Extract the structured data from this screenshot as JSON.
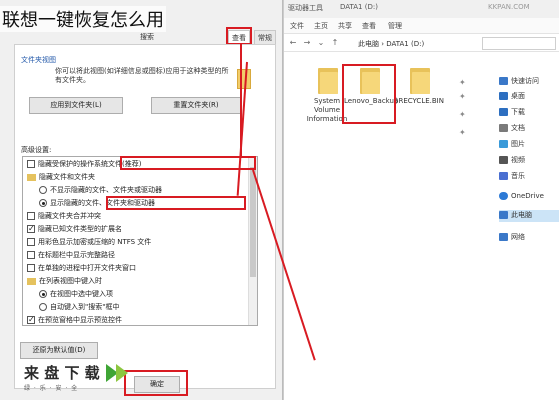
{
  "caption": "联想一键恢复怎么用",
  "explorer": {
    "tabs": [
      "文件",
      "主页",
      "共享",
      "查看",
      "驱动器工具",
      "管理",
      "DATA1 (D:)",
      "KKPAN.COM"
    ],
    "path": "此电脑 › DATA1 (D:)",
    "files": [
      {
        "name": "$RECYCLE.BIN"
      },
      {
        "name": "Lenovo_Backup"
      },
      {
        "name": "System Volume Information"
      }
    ],
    "nav": [
      {
        "label": "快速访问",
        "color": "#3a78c8"
      },
      {
        "label": "桌面",
        "color": "#2d6fc0"
      },
      {
        "label": "下载",
        "color": "#2d6fc0"
      },
      {
        "label": "文档",
        "color": "#7a7a7a"
      },
      {
        "label": "图片",
        "color": "#3a9ad9"
      },
      {
        "label": "视频",
        "color": "#555"
      },
      {
        "label": "音乐",
        "color": "#4a6fd1"
      },
      {
        "label": "OneDrive",
        "color": "#2d7ad6"
      },
      {
        "label": "此电脑",
        "color": "#3a78c8"
      },
      {
        "label": "网络",
        "color": "#3a78c8"
      }
    ]
  },
  "dialog": {
    "tabs": [
      "查看",
      "常规"
    ],
    "subtab": "搜索",
    "folder_views": {
      "title": "文件夹视图",
      "text": "你可以将此视图(如详细信息或图标)应用于这种类型的所有文件夹。",
      "apply_button": "应用到文件夹(L)",
      "reset_button": "重置文件夹(R)"
    },
    "advanced": {
      "title": "高级设置:",
      "items": [
        {
          "kind": "checkbox",
          "checked": false,
          "label": "隐藏受保护的操作系统文件(推荐)",
          "indent": 0
        },
        {
          "kind": "folder",
          "label": "隐藏文件和文件夹",
          "indent": 0
        },
        {
          "kind": "radio",
          "checked": false,
          "label": "不显示隐藏的文件、文件夹或驱动器",
          "indent": 1
        },
        {
          "kind": "radio",
          "checked": true,
          "label": "显示隐藏的文件、文件夹和驱动器",
          "indent": 1
        },
        {
          "kind": "checkbox",
          "checked": false,
          "label": "隐藏文件夹合并冲突",
          "indent": 0
        },
        {
          "kind": "checkbox",
          "checked": true,
          "label": "隐藏已知文件类型的扩展名",
          "indent": 0
        },
        {
          "kind": "checkbox",
          "checked": false,
          "label": "用彩色显示加密或压缩的 NTFS 文件",
          "indent": 0
        },
        {
          "kind": "checkbox",
          "checked": false,
          "label": "在标题栏中显示完整路径",
          "indent": 0
        },
        {
          "kind": "checkbox",
          "checked": false,
          "label": "在单独的进程中打开文件夹窗口",
          "indent": 0
        },
        {
          "kind": "folder",
          "label": "在列表视图中键入时",
          "indent": 0
        },
        {
          "kind": "radio",
          "checked": true,
          "label": "在视图中选中键入项",
          "indent": 1
        },
        {
          "kind": "radio",
          "checked": false,
          "label": "自动键入到\"搜索\"框中",
          "indent": 1
        },
        {
          "kind": "checkbox",
          "checked": true,
          "label": "在预览窗格中显示预览控件",
          "indent": 0
        }
      ]
    },
    "restore_button": "还原为默认值(D)",
    "ok_button": "确定"
  },
  "watermark": {
    "main": "来 盘 下 载",
    "sub": "绿 · 乐 · 安 · 全"
  },
  "colors": {
    "highlight": "#d81b22",
    "folder": "#f6d77a"
  }
}
